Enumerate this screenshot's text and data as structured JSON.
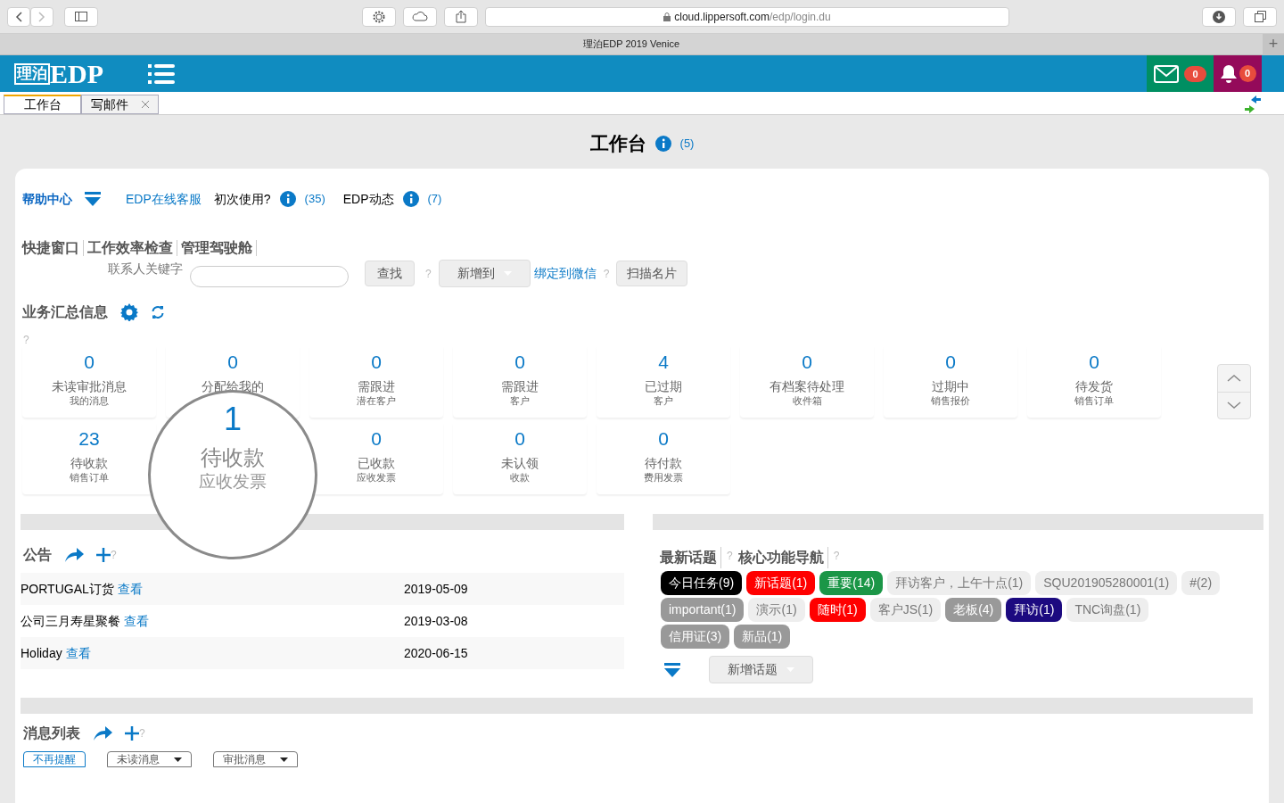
{
  "browser": {
    "url_host": "cloud.lippersoft.com",
    "url_path": "/edp/login.du",
    "tab_title": "理泊EDP 2019 Venice",
    "new_tab": "+"
  },
  "header": {
    "logo_cn": "理泊",
    "logo_en": "EDP",
    "mail_count": "0",
    "bell_count": "0"
  },
  "tabs": [
    {
      "label": "工作台",
      "selected": true,
      "closable": false
    },
    {
      "label": "写邮件",
      "selected": false,
      "closable": true
    }
  ],
  "page_title": "工作台",
  "page_count": "(5)",
  "help": {
    "title": "帮助中心",
    "links": [
      {
        "kind": "link",
        "label": "EDP在线客服"
      },
      {
        "kind": "info",
        "label": "初次使用?",
        "count": "(35)"
      },
      {
        "kind": "info",
        "label": "EDP动态",
        "count": "(7)"
      }
    ]
  },
  "quick_tabs": [
    "快捷窗口",
    "工作效率检查",
    "管理驾驶舱"
  ],
  "contact_search": {
    "label": "联系人关键字",
    "button": "查找",
    "help": "?",
    "add_button": "新增到",
    "wechat_link": "绑定到微信",
    "wechat_help": "?",
    "scan_button": "扫描名片"
  },
  "summary": {
    "title": "业务汇总信息",
    "help": "?",
    "tiles": [
      {
        "value": "0",
        "label": "未读审批消息",
        "sub": "我的消息",
        "magnified": false
      },
      {
        "value": "0",
        "label": "分配给我的",
        "magnified": false
      },
      {
        "value": "0",
        "label": "需跟进",
        "sub": "潜在客户",
        "magnified": false
      },
      {
        "value": "0",
        "label": "需跟进",
        "sub": "客户",
        "magnified": false
      },
      {
        "value": "4",
        "label": "已过期",
        "sub": "客户",
        "magnified": false
      },
      {
        "value": "0",
        "label": "有档案待处理",
        "sub": "收件箱",
        "magnified": false
      },
      {
        "value": "0",
        "label": "过期中",
        "sub": "销售报价",
        "magnified": false
      },
      {
        "value": "0",
        "label": "待发货",
        "sub": "销售订单",
        "magnified": false
      },
      {
        "value": "23",
        "label": "待收款",
        "sub": "销售订单",
        "magnified": false
      },
      {
        "value": "1",
        "label": "待收款",
        "sub": "应收发票",
        "magnified": true
      },
      {
        "value": "0",
        "label": "已收款",
        "sub": "应收发票",
        "magnified": false
      },
      {
        "value": "0",
        "label": "未认领",
        "sub": "收款",
        "magnified": false
      },
      {
        "value": "0",
        "label": "待付款",
        "sub": "费用发票",
        "magnified": false
      }
    ]
  },
  "notices": {
    "title": "公告",
    "help": "?",
    "rows": [
      {
        "title": "PORTUGAL订货",
        "link": "查看",
        "date": "2019-05-09"
      },
      {
        "title": "公司三月寿星聚餐",
        "link": "查看",
        "date": "2019-03-08"
      },
      {
        "title": "Holiday",
        "link": "查看",
        "date": "2020-06-15"
      }
    ]
  },
  "topics": {
    "title": "最新话题",
    "help": "?",
    "nav_title": "核心功能导航",
    "nav_help": "?",
    "add_button": "新增话题",
    "tag_rows": [
      [
        {
          "label": "今日任务(9)",
          "color": "#000000"
        },
        {
          "label": "新话题(1)",
          "color": "#ff0000"
        },
        {
          "label": "重要(14)",
          "color": "#1b9647"
        },
        {
          "label": "拜访客户，上午十点(1)",
          "color": "#eeeeee"
        },
        {
          "label": "SQU201905280001(1)",
          "color": "#eeeeee"
        },
        {
          "label": "#(2)",
          "color": "#eeeeee"
        }
      ],
      [
        {
          "label": "important(1)",
          "color": "#999999"
        },
        {
          "label": "演示(1)",
          "color": "#eeeeee"
        },
        {
          "label": "随时(1)",
          "color": "#ff0000"
        },
        {
          "label": "客户JS(1)",
          "color": "#eeeeee"
        },
        {
          "label": "老板(4)",
          "color": "#999999"
        },
        {
          "label": "拜访(1)",
          "color": "#1c0a80"
        },
        {
          "label": "TNC询盘(1)",
          "color": "#eeeeee"
        }
      ],
      [
        {
          "label": "信用证(3)",
          "color": "#999999"
        },
        {
          "label": "新品(1)",
          "color": "#999999"
        }
      ]
    ]
  },
  "messages": {
    "title": "消息列表",
    "help": "?",
    "filters": [
      {
        "label": "不再提醒",
        "kind": "toggle",
        "selected": true
      },
      {
        "label": "未读消息",
        "kind": "dropdown",
        "selected": false
      },
      {
        "label": "审批消息",
        "kind": "dropdown",
        "selected": false
      }
    ]
  }
}
